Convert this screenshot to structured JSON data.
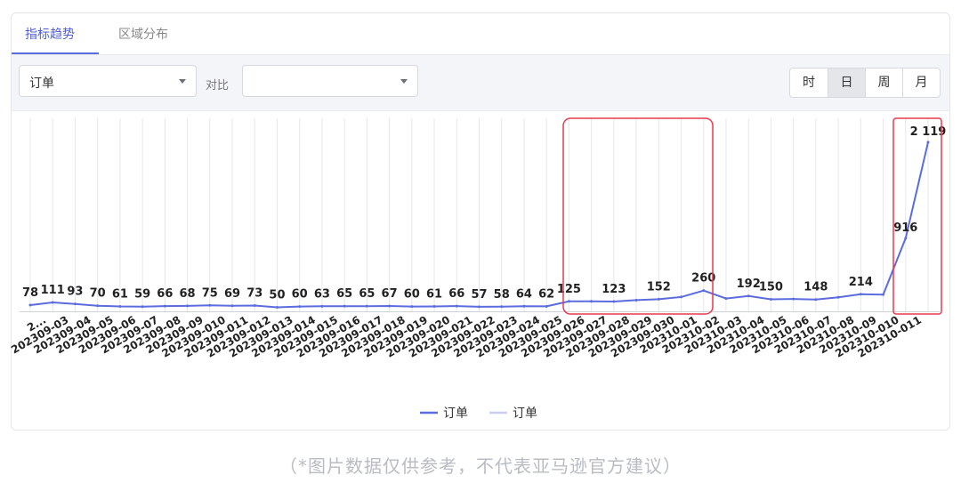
{
  "tabs": [
    {
      "label": "指标趋势",
      "active": true
    },
    {
      "label": "区域分布",
      "active": false
    }
  ],
  "toolbar": {
    "metric_value": "订单",
    "compare_label": "对比",
    "compare_value": "",
    "granularity": [
      "时",
      "日",
      "周",
      "月"
    ],
    "active_granularity": "日"
  },
  "chart_data": {
    "type": "line",
    "categories": [
      "2...",
      "202309-03",
      "202309-04",
      "202309-05",
      "202309-06",
      "202309-07",
      "202309-08",
      "202309-09",
      "202309-010",
      "202309-011",
      "202309-012",
      "202309-013",
      "202309-014",
      "202309-015",
      "202309-016",
      "202309-017",
      "202309-018",
      "202309-019",
      "202309-020",
      "202309-021",
      "202309-022",
      "202309-023",
      "202309-024",
      "202309-025",
      "202309-026",
      "202309-027",
      "202309-028",
      "202309-029",
      "202309-030",
      "202310-01",
      "202310-02",
      "202310-03",
      "202310-04",
      "202310-05",
      "202310-06",
      "202310-07",
      "202310-08",
      "202310-09",
      "202310-010",
      "202310-011"
    ],
    "series": [
      {
        "name": "订单",
        "color": "#5b6cde",
        "values": [
          78,
          111,
          93,
          70,
          61,
          59,
          66,
          68,
          75,
          69,
          73,
          50,
          60,
          63,
          65,
          65,
          67,
          60,
          61,
          66,
          57,
          58,
          64,
          62,
          125,
          125,
          123,
          140,
          152,
          180,
          260,
          160,
          192,
          150,
          155,
          148,
          175,
          214,
          210,
          916,
          2119
        ]
      }
    ],
    "data_labels": [
      "78",
      "111",
      "93",
      "70",
      "61",
      "59",
      "66",
      "68",
      "75",
      "69",
      "73",
      "50",
      "60",
      "63",
      "65",
      "65",
      "67",
      "60",
      "61",
      "66",
      "57",
      "58",
      "64",
      "62",
      "125",
      "",
      "123",
      "",
      "152",
      "",
      "260",
      "",
      "192",
      "150",
      "",
      "148",
      "",
      "214",
      "",
      "916",
      "2 119"
    ],
    "legend": [
      {
        "label": "订单",
        "color": "#5b6cde"
      },
      {
        "label": "订单",
        "color": "#c9cdf1"
      }
    ],
    "legend_position": "bottom",
    "grid": "vertical",
    "highlight_color": "#e83a4f"
  },
  "footnote": "（*图片数据仅供参考，不代表亚马逊官方建议）"
}
